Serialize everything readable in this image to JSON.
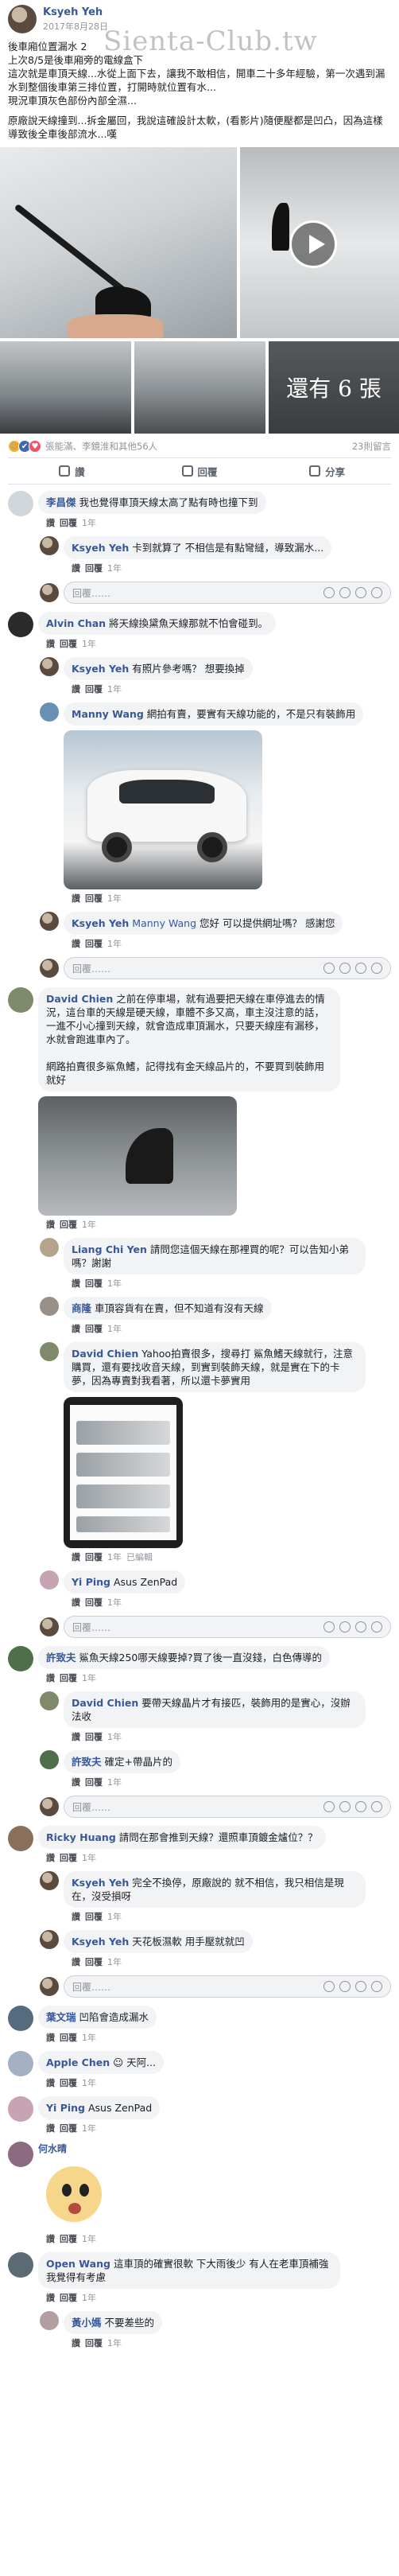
{
  "post": {
    "author": "Ksyeh Yeh",
    "date": "2017年8月28日",
    "watermark": "Sienta-Club.tw",
    "lines": [
      "後車廂位置漏水 2",
      "上次8/5是後車廂旁的電線盒下",
      "這次就是車頂天線...水從上面下去，讓我不敢相信，開車二十多年經驗，第一次遇到漏水到整個後車第三排位置，打開時就位置有水...",
      "現況車頂灰色部份內部全濕..."
    ],
    "lines2": [
      "原廠說天線撞到...拆金屬回，我說這確設計太軟，(看影片)隨便壓都是凹凸，因為這樣導致後全車後部流水...嘆"
    ],
    "more_photos": "還有 6 張",
    "reactions_text": "張能滿、李鏡淮和其他56人",
    "comments_count": "23則留言",
    "actions": {
      "like": "讚",
      "comment": "回覆",
      "share": "分享"
    }
  },
  "write_placeholder": "回覆……",
  "meta": {
    "like": "讚",
    "reply": "回覆",
    "time": "1年",
    "edited": "已編輯"
  },
  "comments": [
    {
      "name": "李昌傑",
      "text": "我也覺得車頂天線太高了點有時也撞下到"
    },
    {
      "name": "Ksyeh Yeh",
      "text": "卡到就算了 不相信是有點彎縫，導致漏水..."
    },
    {
      "name": "Alvin Chan",
      "text": "將天線換黛魚天線那就不怕會碰到。"
    },
    {
      "name": "Ksyeh Yeh",
      "text": "有照片參考嗎？ 想要換掉"
    },
    {
      "name": "Manny Wang",
      "text": "網拍有賣，要實有天線功能的，不是只有裝飾用"
    },
    {
      "name": "Ksyeh Yeh",
      "mention": "Manny Wang",
      "text": "您好 可以提供網址嗎？ 感謝您"
    },
    {
      "name": "David Chien",
      "text": "之前在停車場，就有過要把天線在車停進去的情況，這台車的天線是硬天線，車體不多又高，車主沒注意的話，一進不小心撞到天線，就會造成車頂漏水，只要天線座有漏移，水就會跑進車內了。",
      "text2": "網路拍賣很多鯊魚鰭，記得找有金天線品片的，不要買到裝飾用就好"
    },
    {
      "name": "Liang Chi Yen",
      "text": "請問您這個天線在那裡買的呢？可以告知小弟嗎？謝謝"
    },
    {
      "name": "商隆",
      "text": "車頂容貨有在賣，但不知道有沒有天線"
    },
    {
      "name": "David Chien",
      "text": "Yahoo拍賣很多，搜尋打 鯊魚鰭天線就行，注意購買，還有要找收音天線，到實到裝飾天線，就是實在下的卡夢，因為專賣對我看著，所以還卡夢實用"
    },
    {
      "name": "Yi Ping",
      "text": "Asus ZenPad"
    },
    {
      "name": "許致夫",
      "text": "鯊魚天線250哪天線要掉?買了後一直沒錢，白色傳導的"
    },
    {
      "name": "David Chien",
      "text": "要帶天線晶片才有接匹，裝飾用的是實心，沒辦法收"
    },
    {
      "name": "許致夫",
      "text": "確定+帶晶片的"
    },
    {
      "name": "Ricky Huang",
      "text": "請問在那會推到天線？還照車頂鍍金爐位？？"
    },
    {
      "name": "Ksyeh Yeh",
      "text": "完全不換停，原廠說的 就不相信，我只相信是現在，沒受損呀"
    },
    {
      "name": "Ksyeh Yeh",
      "text": "天花板濕軟 用手壓就就凹"
    },
    {
      "name": "葉文瑞",
      "text": "凹陷會造成漏水"
    },
    {
      "name": "Apple Chen",
      "text": "☺ 天阿..."
    },
    {
      "name": "Yi Ping",
      "text": "Asus ZenPad"
    },
    {
      "name": "何水晴",
      "text": ""
    },
    {
      "name": "Open Wang",
      "text": "這車頂的確實很軟 下大雨後少 有人在老車頂補強 我覺得有考慮"
    },
    {
      "name": "黃小媽",
      "text": "不要差些的"
    }
  ]
}
